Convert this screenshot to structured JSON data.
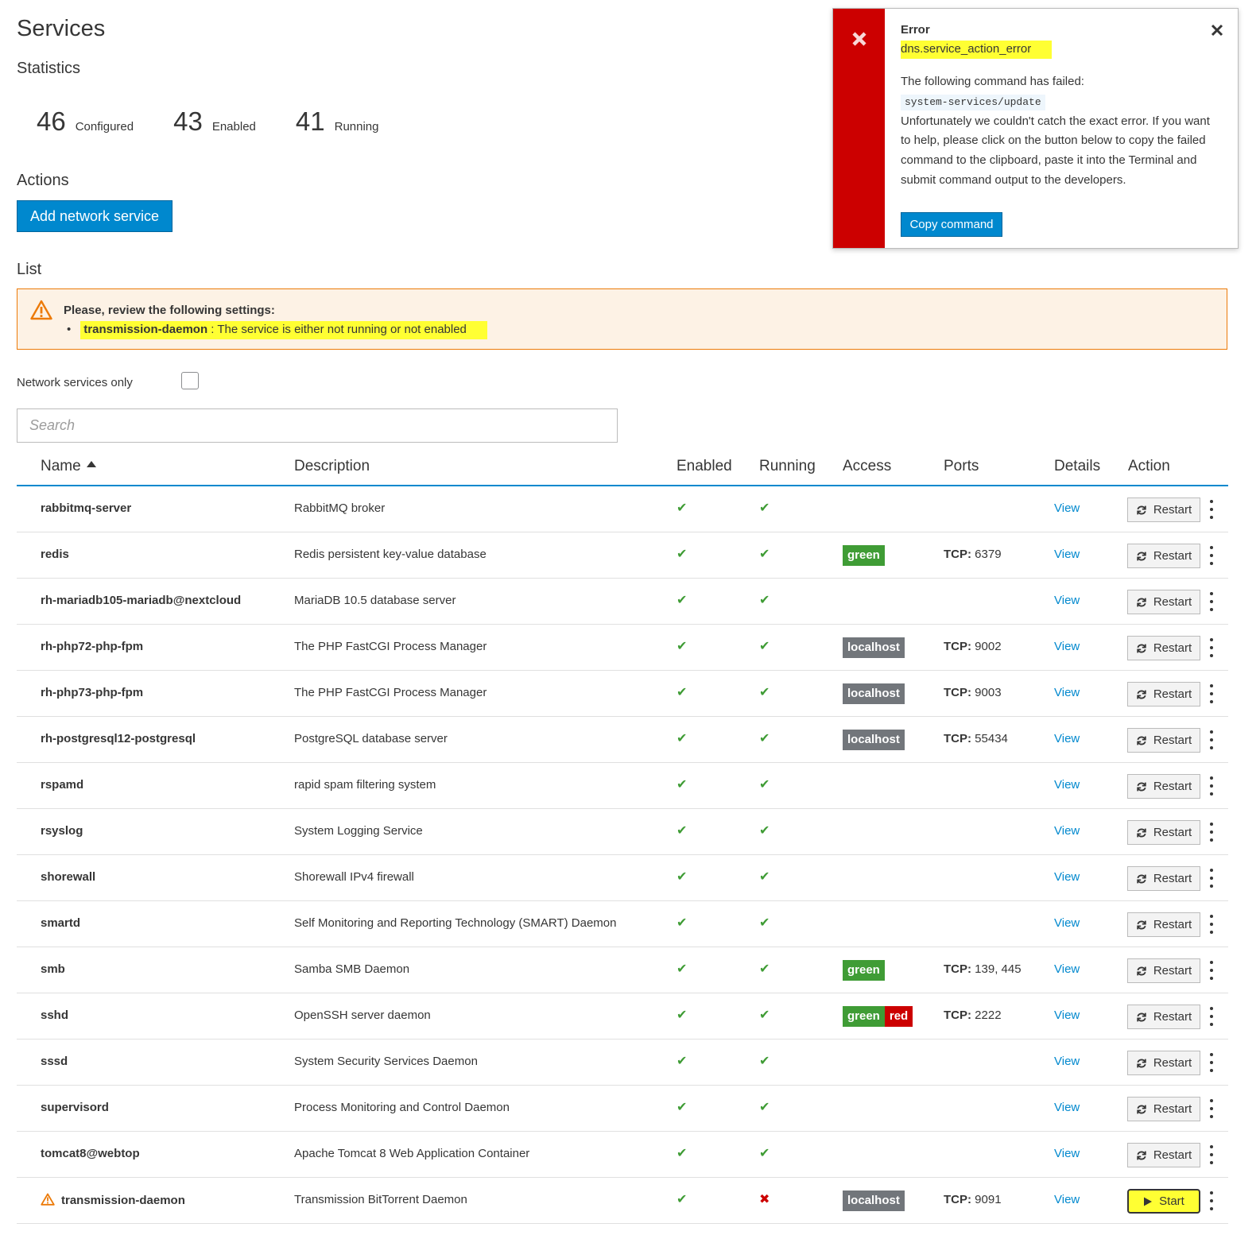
{
  "page": {
    "title": "Services"
  },
  "statistics": {
    "title": "Statistics",
    "items": [
      {
        "value": "46",
        "label": "Configured"
      },
      {
        "value": "43",
        "label": "Enabled"
      },
      {
        "value": "41",
        "label": "Running"
      }
    ]
  },
  "actions": {
    "title": "Actions",
    "add_label": "Add network service"
  },
  "list": {
    "title": "List",
    "warning": {
      "title": "Please, review the following settings:",
      "service": "transmission-daemon",
      "message": " : The service is either not running or not enabled"
    },
    "filter_label": "Network services only",
    "search_placeholder": "Search",
    "columns": [
      "Name",
      "Description",
      "Enabled",
      "Running",
      "Access",
      "Ports",
      "Details",
      "Action"
    ],
    "rows": [
      {
        "name": "rabbitmq-server",
        "description": "RabbitMQ broker",
        "enabled": "✔",
        "running": "✔",
        "access": [],
        "ports_proto": "",
        "ports_value": "",
        "details": "View",
        "action": "Restart"
      },
      {
        "name": "redis",
        "description": "Redis persistent key-value database",
        "enabled": "✔",
        "running": "✔",
        "access": [
          "green"
        ],
        "ports_proto": "TCP:",
        "ports_value": " 6379",
        "details": "View",
        "action": "Restart"
      },
      {
        "name": "rh-mariadb105-mariadb@nextcloud",
        "description": "MariaDB 10.5 database server",
        "enabled": "✔",
        "running": "✔",
        "access": [],
        "ports_proto": "",
        "ports_value": "",
        "details": "View",
        "action": "Restart"
      },
      {
        "name": "rh-php72-php-fpm",
        "description": "The PHP FastCGI Process Manager",
        "enabled": "✔",
        "running": "✔",
        "access": [
          "localhost"
        ],
        "ports_proto": "TCP:",
        "ports_value": " 9002",
        "details": "View",
        "action": "Restart"
      },
      {
        "name": "rh-php73-php-fpm",
        "description": "The PHP FastCGI Process Manager",
        "enabled": "✔",
        "running": "✔",
        "access": [
          "localhost"
        ],
        "ports_proto": "TCP:",
        "ports_value": " 9003",
        "details": "View",
        "action": "Restart"
      },
      {
        "name": "rh-postgresql12-postgresql",
        "description": "PostgreSQL database server",
        "enabled": "✔",
        "running": "✔",
        "access": [
          "localhost"
        ],
        "ports_proto": "TCP:",
        "ports_value": " 55434",
        "details": "View",
        "action": "Restart"
      },
      {
        "name": "rspamd",
        "description": "rapid spam filtering system",
        "enabled": "✔",
        "running": "✔",
        "access": [],
        "ports_proto": "",
        "ports_value": "",
        "details": "View",
        "action": "Restart"
      },
      {
        "name": "rsyslog",
        "description": "System Logging Service",
        "enabled": "✔",
        "running": "✔",
        "access": [],
        "ports_proto": "",
        "ports_value": "",
        "details": "View",
        "action": "Restart"
      },
      {
        "name": "shorewall",
        "description": "Shorewall IPv4 firewall",
        "enabled": "✔",
        "running": "✔",
        "access": [],
        "ports_proto": "",
        "ports_value": "",
        "details": "View",
        "action": "Restart"
      },
      {
        "name": "smartd",
        "description": "Self Monitoring and Reporting Technology (SMART) Daemon",
        "enabled": "✔",
        "running": "✔",
        "access": [],
        "ports_proto": "",
        "ports_value": "",
        "details": "View",
        "action": "Restart"
      },
      {
        "name": "smb",
        "description": "Samba SMB Daemon",
        "enabled": "✔",
        "running": "✔",
        "access": [
          "green"
        ],
        "ports_proto": "TCP:",
        "ports_value": " 139, 445",
        "details": "View",
        "action": "Restart"
      },
      {
        "name": "sshd",
        "description": "OpenSSH server daemon",
        "enabled": "✔",
        "running": "✔",
        "access": [
          "green",
          "red"
        ],
        "ports_proto": "TCP:",
        "ports_value": " 2222",
        "details": "View",
        "action": "Restart"
      },
      {
        "name": "sssd",
        "description": "System Security Services Daemon",
        "enabled": "✔",
        "running": "✔",
        "access": [],
        "ports_proto": "",
        "ports_value": "",
        "details": "View",
        "action": "Restart"
      },
      {
        "name": "supervisord",
        "description": "Process Monitoring and Control Daemon",
        "enabled": "✔",
        "running": "✔",
        "access": [],
        "ports_proto": "",
        "ports_value": "",
        "details": "View",
        "action": "Restart"
      },
      {
        "name": "tomcat8@webtop",
        "description": "Apache Tomcat 8 Web Application Container",
        "enabled": "✔",
        "running": "✔",
        "access": [],
        "ports_proto": "",
        "ports_value": "",
        "details": "View",
        "action": "Restart"
      },
      {
        "name": "transmission-daemon",
        "description": "Transmission BitTorrent Daemon",
        "enabled": "✔",
        "running": "✖",
        "access": [
          "localhost"
        ],
        "ports_proto": "TCP:",
        "ports_value": " 9091",
        "details": "View",
        "action": "Start",
        "warning": true
      }
    ]
  },
  "toast": {
    "title": "Error",
    "code": "dns.service_action_error",
    "intro": "The following command has failed:",
    "command": "system-services/update",
    "message": "Unfortunately we couldn't catch the exact error. If you want to help, please click on the button below to copy the failed command to the clipboard, paste it into the Terminal and submit command output to the developers.",
    "button_label": "Copy command"
  },
  "colors": {
    "primary": "#0088ce",
    "success": "#3f9c35",
    "danger": "#cc0000",
    "neutral_badge": "#72767b",
    "warning_border": "#ec7a08",
    "warning_bg": "#fdf2e5",
    "highlight": "#ffff33"
  },
  "icons": [
    "warning-triangle-icon",
    "sort-ascending-icon",
    "check-icon",
    "cross-icon",
    "refresh-icon",
    "play-icon",
    "kebab-icon",
    "error-x-icon",
    "close-icon"
  ]
}
